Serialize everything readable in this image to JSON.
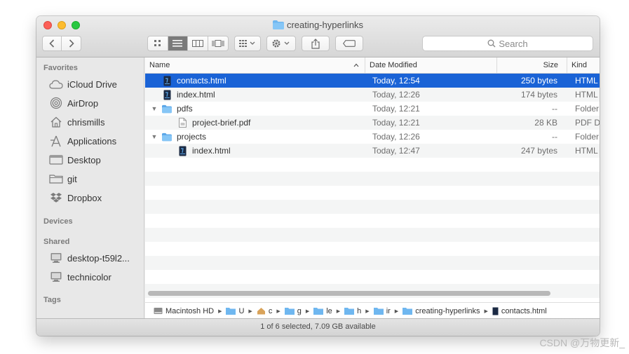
{
  "window": {
    "title": "creating-hyperlinks"
  },
  "toolbar": {
    "search_placeholder": "Search"
  },
  "sidebar": {
    "favorites_header": "Favorites",
    "favorites": [
      {
        "label": "iCloud Drive",
        "icon": "cloud-icon"
      },
      {
        "label": "AirDrop",
        "icon": "airdrop-icon"
      },
      {
        "label": "chrismills",
        "icon": "home-icon"
      },
      {
        "label": "Applications",
        "icon": "applications-icon"
      },
      {
        "label": "Desktop",
        "icon": "desktop-icon"
      },
      {
        "label": "git",
        "icon": "folder-icon"
      },
      {
        "label": "Dropbox",
        "icon": "dropbox-icon"
      }
    ],
    "devices_header": "Devices",
    "shared_header": "Shared",
    "shared": [
      {
        "label": "desktop-t59l2...",
        "icon": "computer-icon"
      },
      {
        "label": "technicolor",
        "icon": "computer-icon"
      }
    ],
    "tags_header": "Tags"
  },
  "columns": {
    "name": "Name",
    "date": "Date Modified",
    "size": "Size",
    "kind": "Kind"
  },
  "files": [
    {
      "name": "contacts.html",
      "date": "Today, 12:54",
      "size": "250 bytes",
      "kind": "HTML",
      "type": "html",
      "depth": 0,
      "selected": true
    },
    {
      "name": "index.html",
      "date": "Today, 12:26",
      "size": "174 bytes",
      "kind": "HTML",
      "type": "html",
      "depth": 0
    },
    {
      "name": "pdfs",
      "date": "Today, 12:21",
      "size": "--",
      "kind": "Folder",
      "type": "folder",
      "depth": 0,
      "expanded": true
    },
    {
      "name": "project-brief.pdf",
      "date": "Today, 12:21",
      "size": "28 KB",
      "kind": "PDF D",
      "type": "pdf",
      "depth": 1
    },
    {
      "name": "projects",
      "date": "Today, 12:26",
      "size": "--",
      "kind": "Folder",
      "type": "folder",
      "depth": 0,
      "expanded": true
    },
    {
      "name": "index.html",
      "date": "Today, 12:47",
      "size": "247 bytes",
      "kind": "HTML",
      "type": "html",
      "depth": 1
    }
  ],
  "pathbar": [
    {
      "label": "Macintosh HD",
      "icon": "disk-icon"
    },
    {
      "label": "U",
      "icon": "users-folder-icon"
    },
    {
      "label": "c",
      "icon": "home-icon"
    },
    {
      "label": "g",
      "icon": "folder-icon"
    },
    {
      "label": "le",
      "icon": "folder-icon"
    },
    {
      "label": "h",
      "icon": "folder-icon"
    },
    {
      "label": "ir",
      "icon": "folder-icon"
    },
    {
      "label": "creating-hyperlinks",
      "icon": "folder-icon"
    },
    {
      "label": "contacts.html",
      "icon": "html-file-icon"
    }
  ],
  "status": "1 of 6 selected, 7.09 GB available",
  "watermark": "CSDN @万物更新_",
  "colors": {
    "selection": "#1a63d6",
    "folder": "#6fb7f0",
    "accent_close": "#fc5f57",
    "accent_min": "#fdbc2e",
    "accent_max": "#28c840"
  }
}
